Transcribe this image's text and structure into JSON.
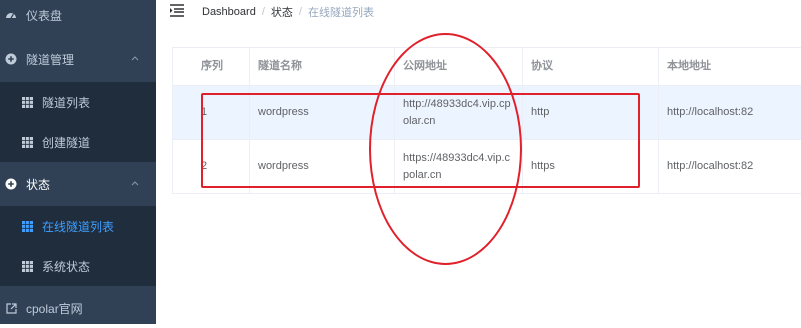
{
  "sidebar": {
    "dashboard": {
      "label": "仪表盘",
      "icon": "dashboard-icon"
    },
    "tunnel_mgmt": {
      "label": "隧道管理",
      "icon": "plus-circle-icon"
    },
    "tunnel_list": {
      "label": "隧道列表",
      "icon": "grid-icon"
    },
    "create_tunnel": {
      "label": "创建隧道",
      "icon": "grid-icon"
    },
    "status": {
      "label": "状态",
      "icon": "plus-circle-icon"
    },
    "online_list": {
      "label": "在线隧道列表",
      "icon": "grid-icon"
    },
    "system_status": {
      "label": "系统状态",
      "icon": "grid-icon"
    },
    "website": {
      "label": "cpolar官网",
      "icon": "external-link-icon"
    }
  },
  "breadcrumb": {
    "items": [
      "Dashboard",
      "状态",
      "在线隧道列表"
    ],
    "separator": "/"
  },
  "table": {
    "headers": [
      "序列",
      "隧道名称",
      "公网地址",
      "协议",
      "本地地址"
    ],
    "rows": [
      {
        "index": "1",
        "name": "wordpress",
        "public_url": "http://48933dc4.vip.cpolar.cn",
        "protocol": "http",
        "local": "http://localhost:82"
      },
      {
        "index": "2",
        "name": "wordpress",
        "public_url": "https://48933dc4.vip.cpolar.cn",
        "protocol": "https",
        "local": "http://localhost:82"
      }
    ]
  },
  "colors": {
    "sidebar_bg": "#304156",
    "submenu_bg": "#1f2d3d",
    "active": "#409eff",
    "annotation": "#e0202a",
    "row_highlight": "#ecf5ff"
  }
}
